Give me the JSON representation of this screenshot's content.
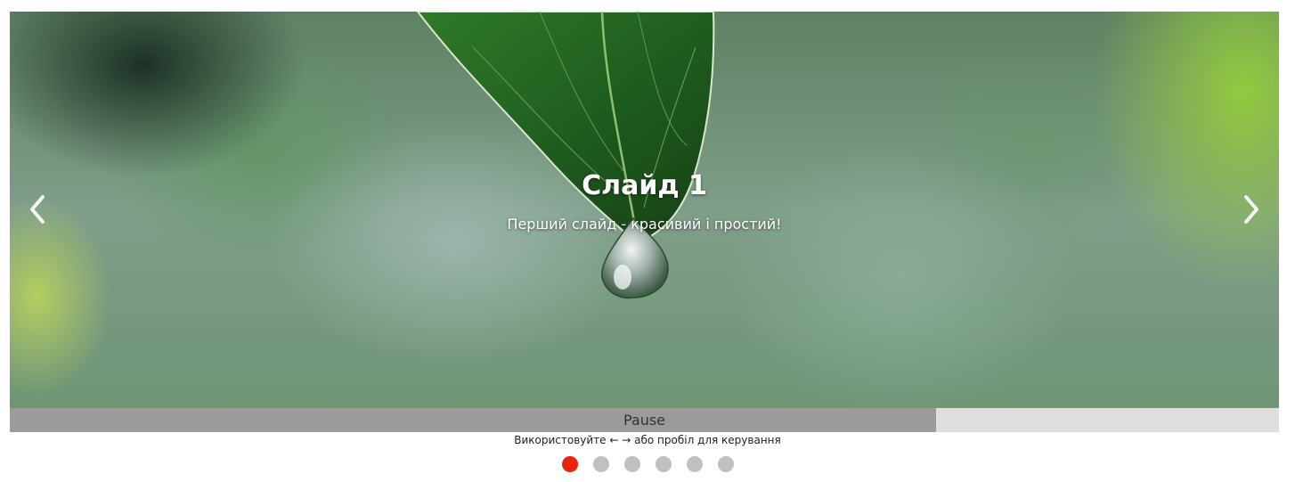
{
  "slider": {
    "slide": {
      "title": "Слайд 1",
      "text": "Перший слайд - красивий і простий!"
    },
    "pause": {
      "label": "Pause",
      "progress": 0.73
    },
    "hint": "Використовуйте ← → або пробіл для керування",
    "dots": [
      {
        "active": true
      },
      {
        "active": false
      },
      {
        "active": false
      },
      {
        "active": false
      },
      {
        "active": false
      },
      {
        "active": false
      }
    ]
  },
  "colors": {
    "active_dot": "#e8230e",
    "inactive_dot": "#c0c0c0",
    "pause_fill": "#9b9b9b",
    "pause_track": "#dedede"
  },
  "icons": {
    "prev": "chevron-left-icon",
    "next": "chevron-right-icon"
  }
}
